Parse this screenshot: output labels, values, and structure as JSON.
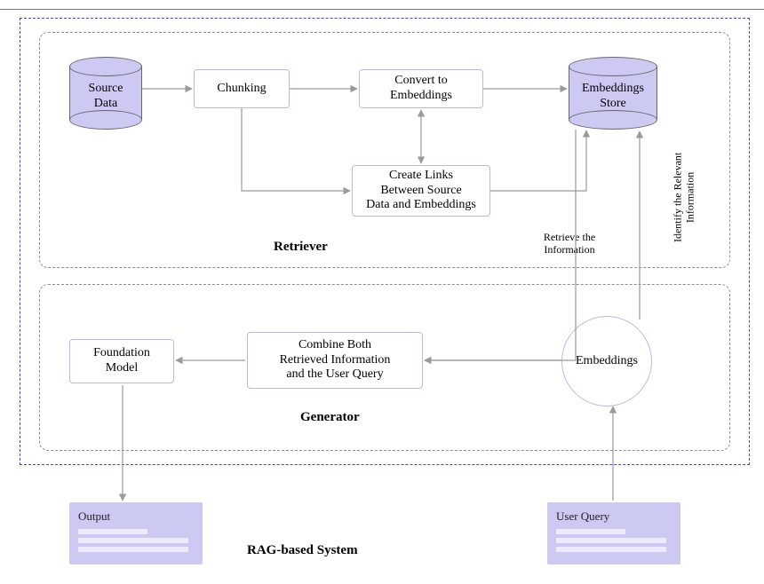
{
  "divider": true,
  "outer_title": "RAG-based System",
  "retriever": {
    "title": "Retriever",
    "source_data": "Source\nData",
    "chunking": "Chunking",
    "convert": "Convert to\nEmbeddings",
    "store": "Embeddings\nStore",
    "create_links": "Create Links\nBetween Source\nData and Embeddings",
    "retrieve_label": "Retrieve the\nInformation",
    "identify_label": "Identify the Relevant\nInformation"
  },
  "generator": {
    "title": "Generator",
    "foundation_model": "Foundation\nModel",
    "combine": "Combine Both\nRetrieved Information\nand the User Query",
    "embeddings": "Embeddings"
  },
  "output_card": "Output",
  "user_query_card": "User Query"
}
